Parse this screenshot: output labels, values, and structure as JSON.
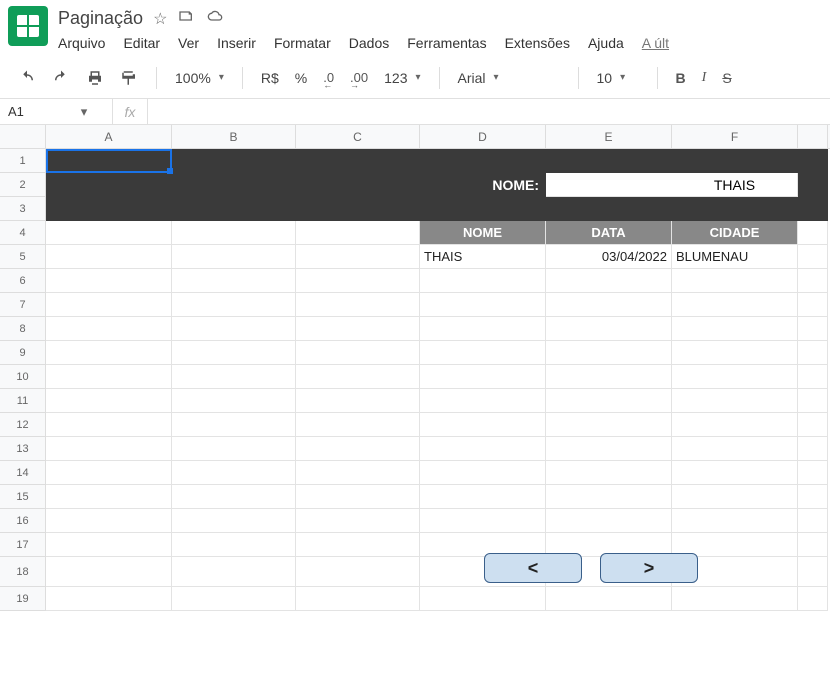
{
  "doc": {
    "title": "Paginação"
  },
  "title_icons": {
    "star": "☆",
    "move": "▭",
    "cloud": "☁"
  },
  "menu": {
    "arquivo": "Arquivo",
    "editar": "Editar",
    "ver": "Ver",
    "inserir": "Inserir",
    "formatar": "Formatar",
    "dados": "Dados",
    "ferramentas": "Ferramentas",
    "extensoes": "Extensões",
    "ajuda": "Ajuda",
    "last": "A últ"
  },
  "toolbar": {
    "zoom": "100%",
    "currency": "R$",
    "percent": "%",
    "dec_dec": ".0",
    "dec_sub": "←",
    "inc_dec": ".00",
    "inc_sub": "→",
    "numfmt": "123",
    "font": "Arial",
    "size": "10"
  },
  "namebox": {
    "ref": "A1",
    "fx": "fx"
  },
  "cols": {
    "A": "A",
    "B": "B",
    "C": "C",
    "D": "D",
    "E": "E",
    "F": "F"
  },
  "rows_n": [
    "1",
    "2",
    "3",
    "4",
    "5",
    "6",
    "7",
    "8",
    "9",
    "10",
    "11",
    "12",
    "13",
    "14",
    "15",
    "16",
    "17",
    "18",
    "19"
  ],
  "banner": {
    "label": "NOME:",
    "value": "THAIS"
  },
  "table": {
    "headers": {
      "nome": "NOME",
      "data": "DATA",
      "cidade": "CIDADE"
    },
    "row": {
      "nome": "THAIS",
      "data": "03/04/2022",
      "cidade": "BLUMENAU"
    }
  },
  "pager": {
    "prev": "<",
    "next": ">"
  }
}
